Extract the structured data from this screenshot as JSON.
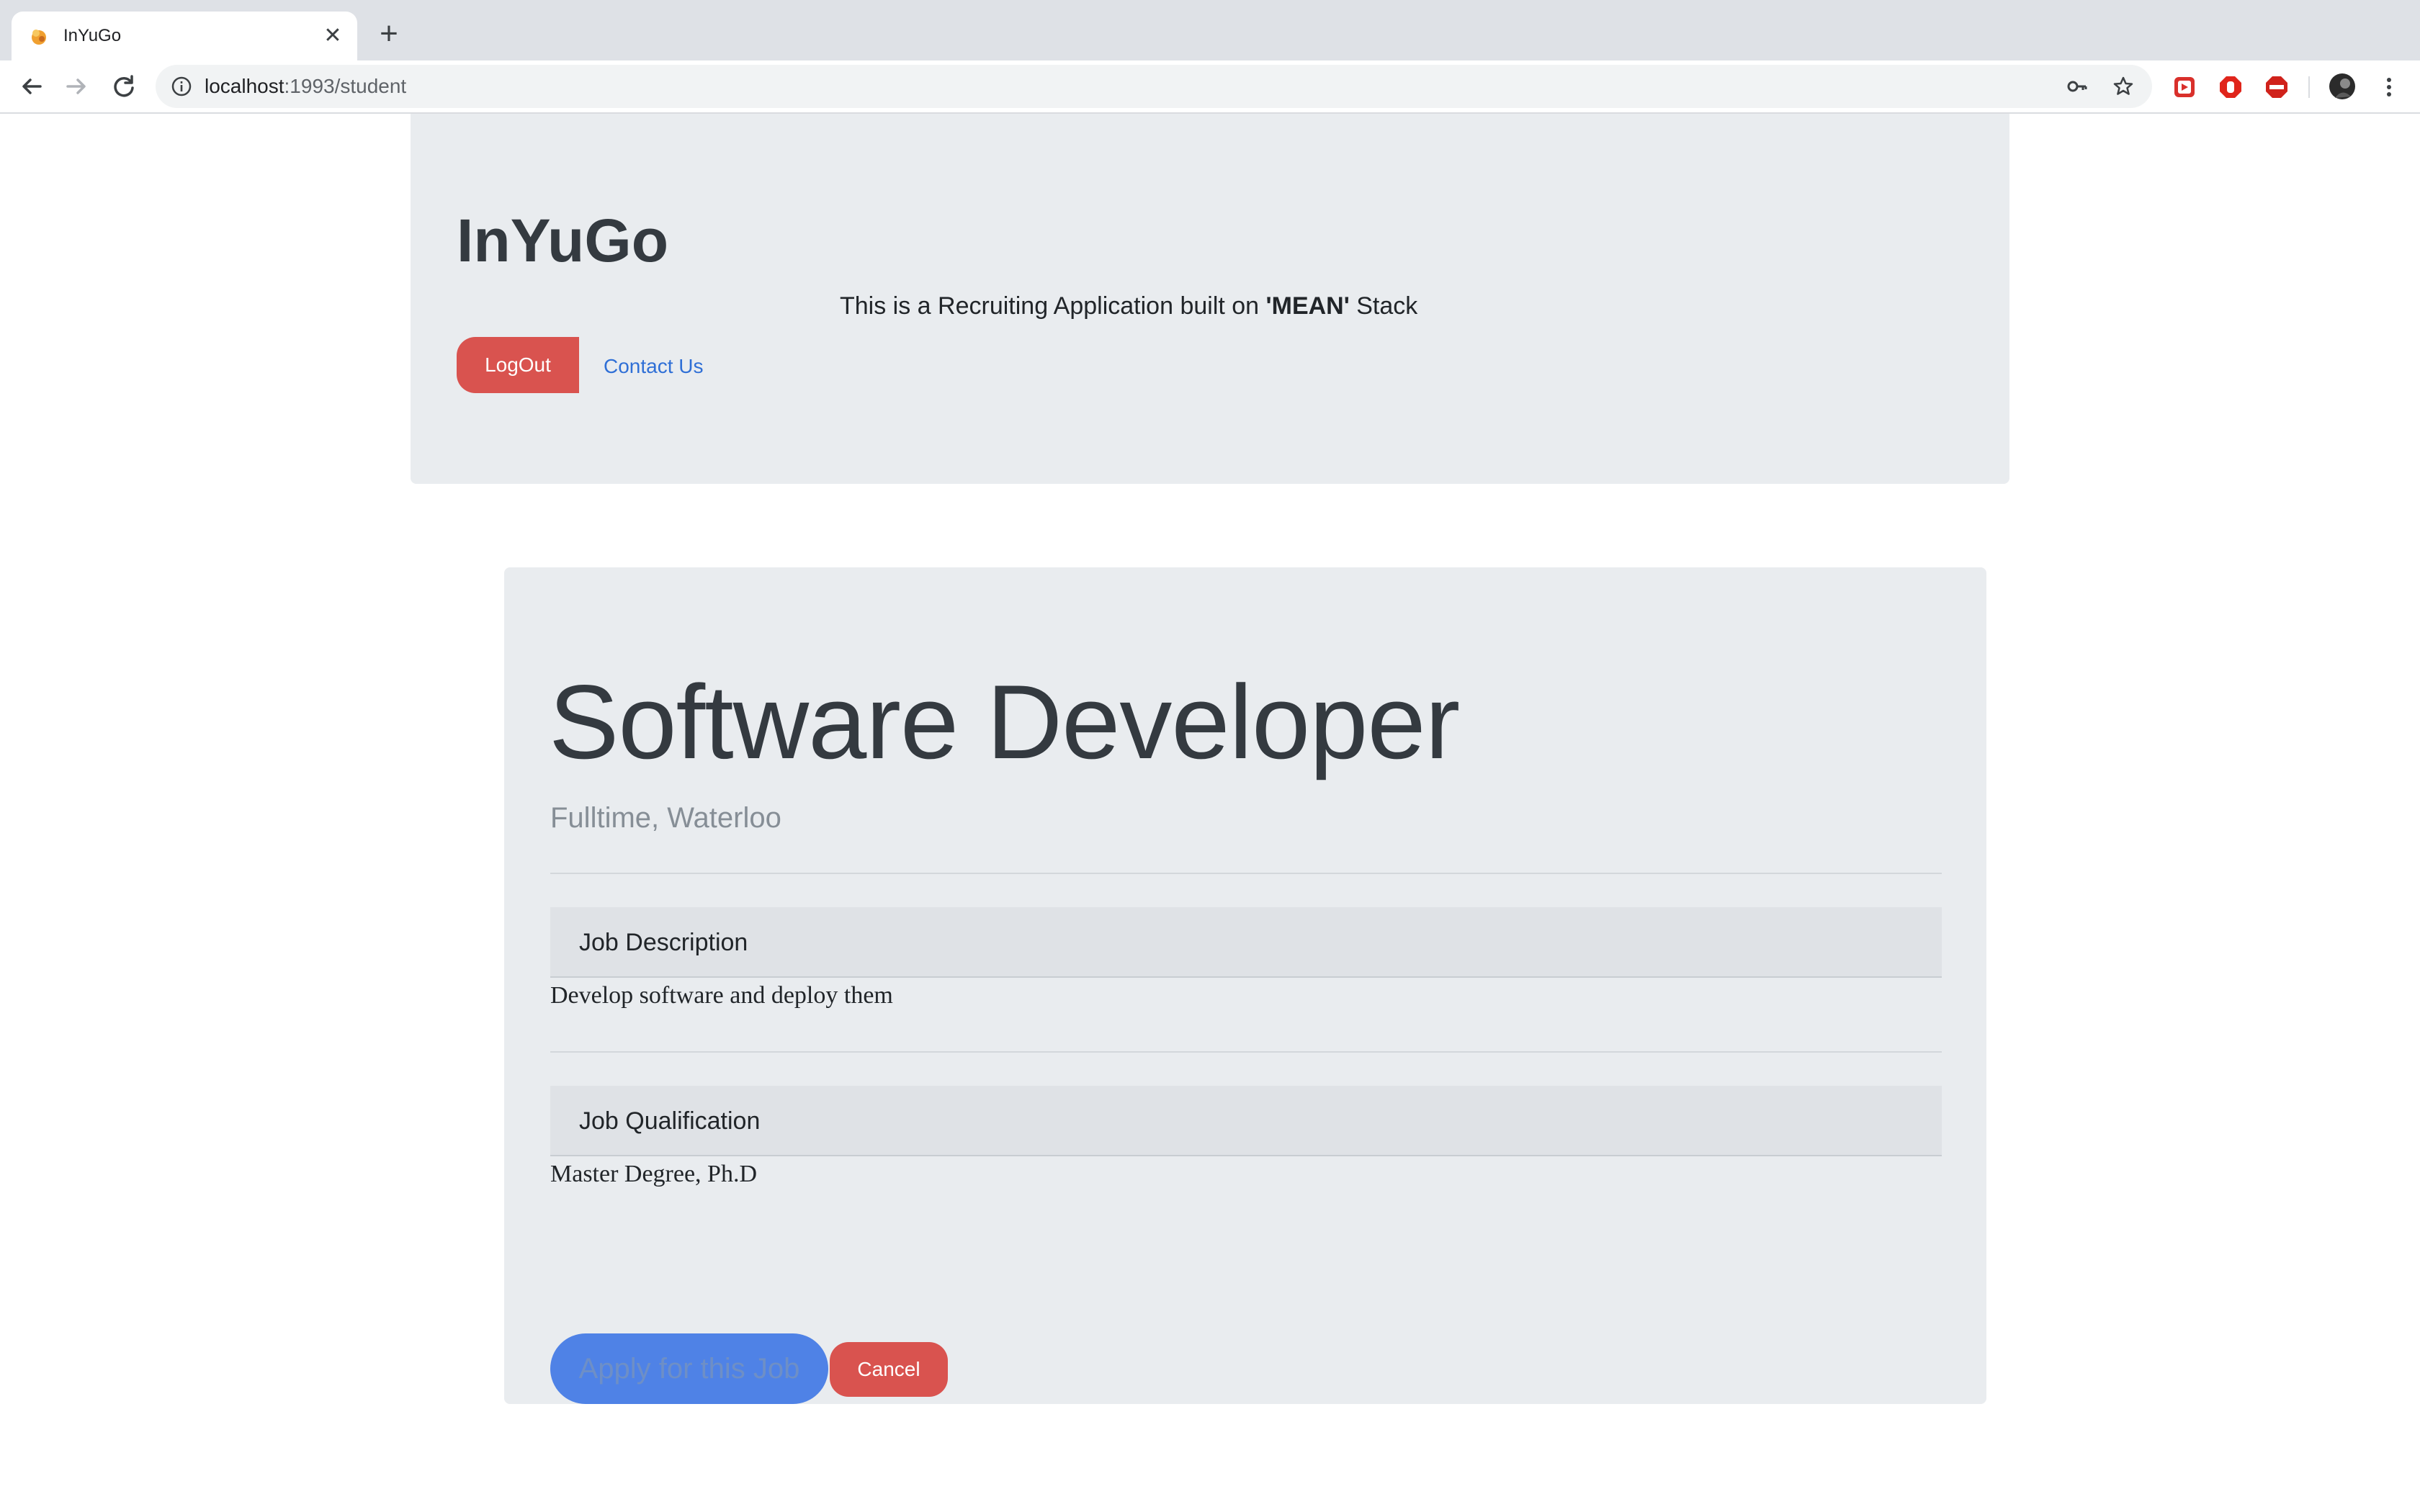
{
  "browser": {
    "tab_title": "InYuGo",
    "tab_close_glyph": "✕",
    "new_tab_glyph": "+",
    "url_host": "localhost",
    "url_path": ":1993/student",
    "icons": {
      "back": "back-arrow-icon",
      "forward": "forward-arrow-icon",
      "reload": "reload-icon",
      "info": "info-icon",
      "key": "key-icon",
      "star": "bookmark-star-icon",
      "ext1": "video-extension-icon",
      "ext2": "stop-extension-icon",
      "ext3": "adblock-plus-icon",
      "profile": "profile-avatar-icon",
      "menu": "kebab-menu-icon"
    }
  },
  "header": {
    "brand": "InYuGo",
    "tagline_prefix": "This is a Recruiting Application built on ",
    "tagline_bold": "'MEAN'",
    "tagline_suffix": " Stack",
    "logout_label": "LogOut",
    "contact_label": "Contact Us"
  },
  "job": {
    "title": "Software Developer",
    "subtitle": "Fulltime, Waterloo",
    "description_heading": "Job Description",
    "description_text": "Develop software and deploy them",
    "qualification_heading": "Job Qualification",
    "qualification_text": "Master Degree, Ph.D",
    "apply_label": "Apply for this Job",
    "cancel_label": "Cancel"
  },
  "colors": {
    "danger": "#d9534f",
    "primary": "#4f82e6",
    "jumbotron": "#e9ecef",
    "link": "#2f6fd6"
  }
}
